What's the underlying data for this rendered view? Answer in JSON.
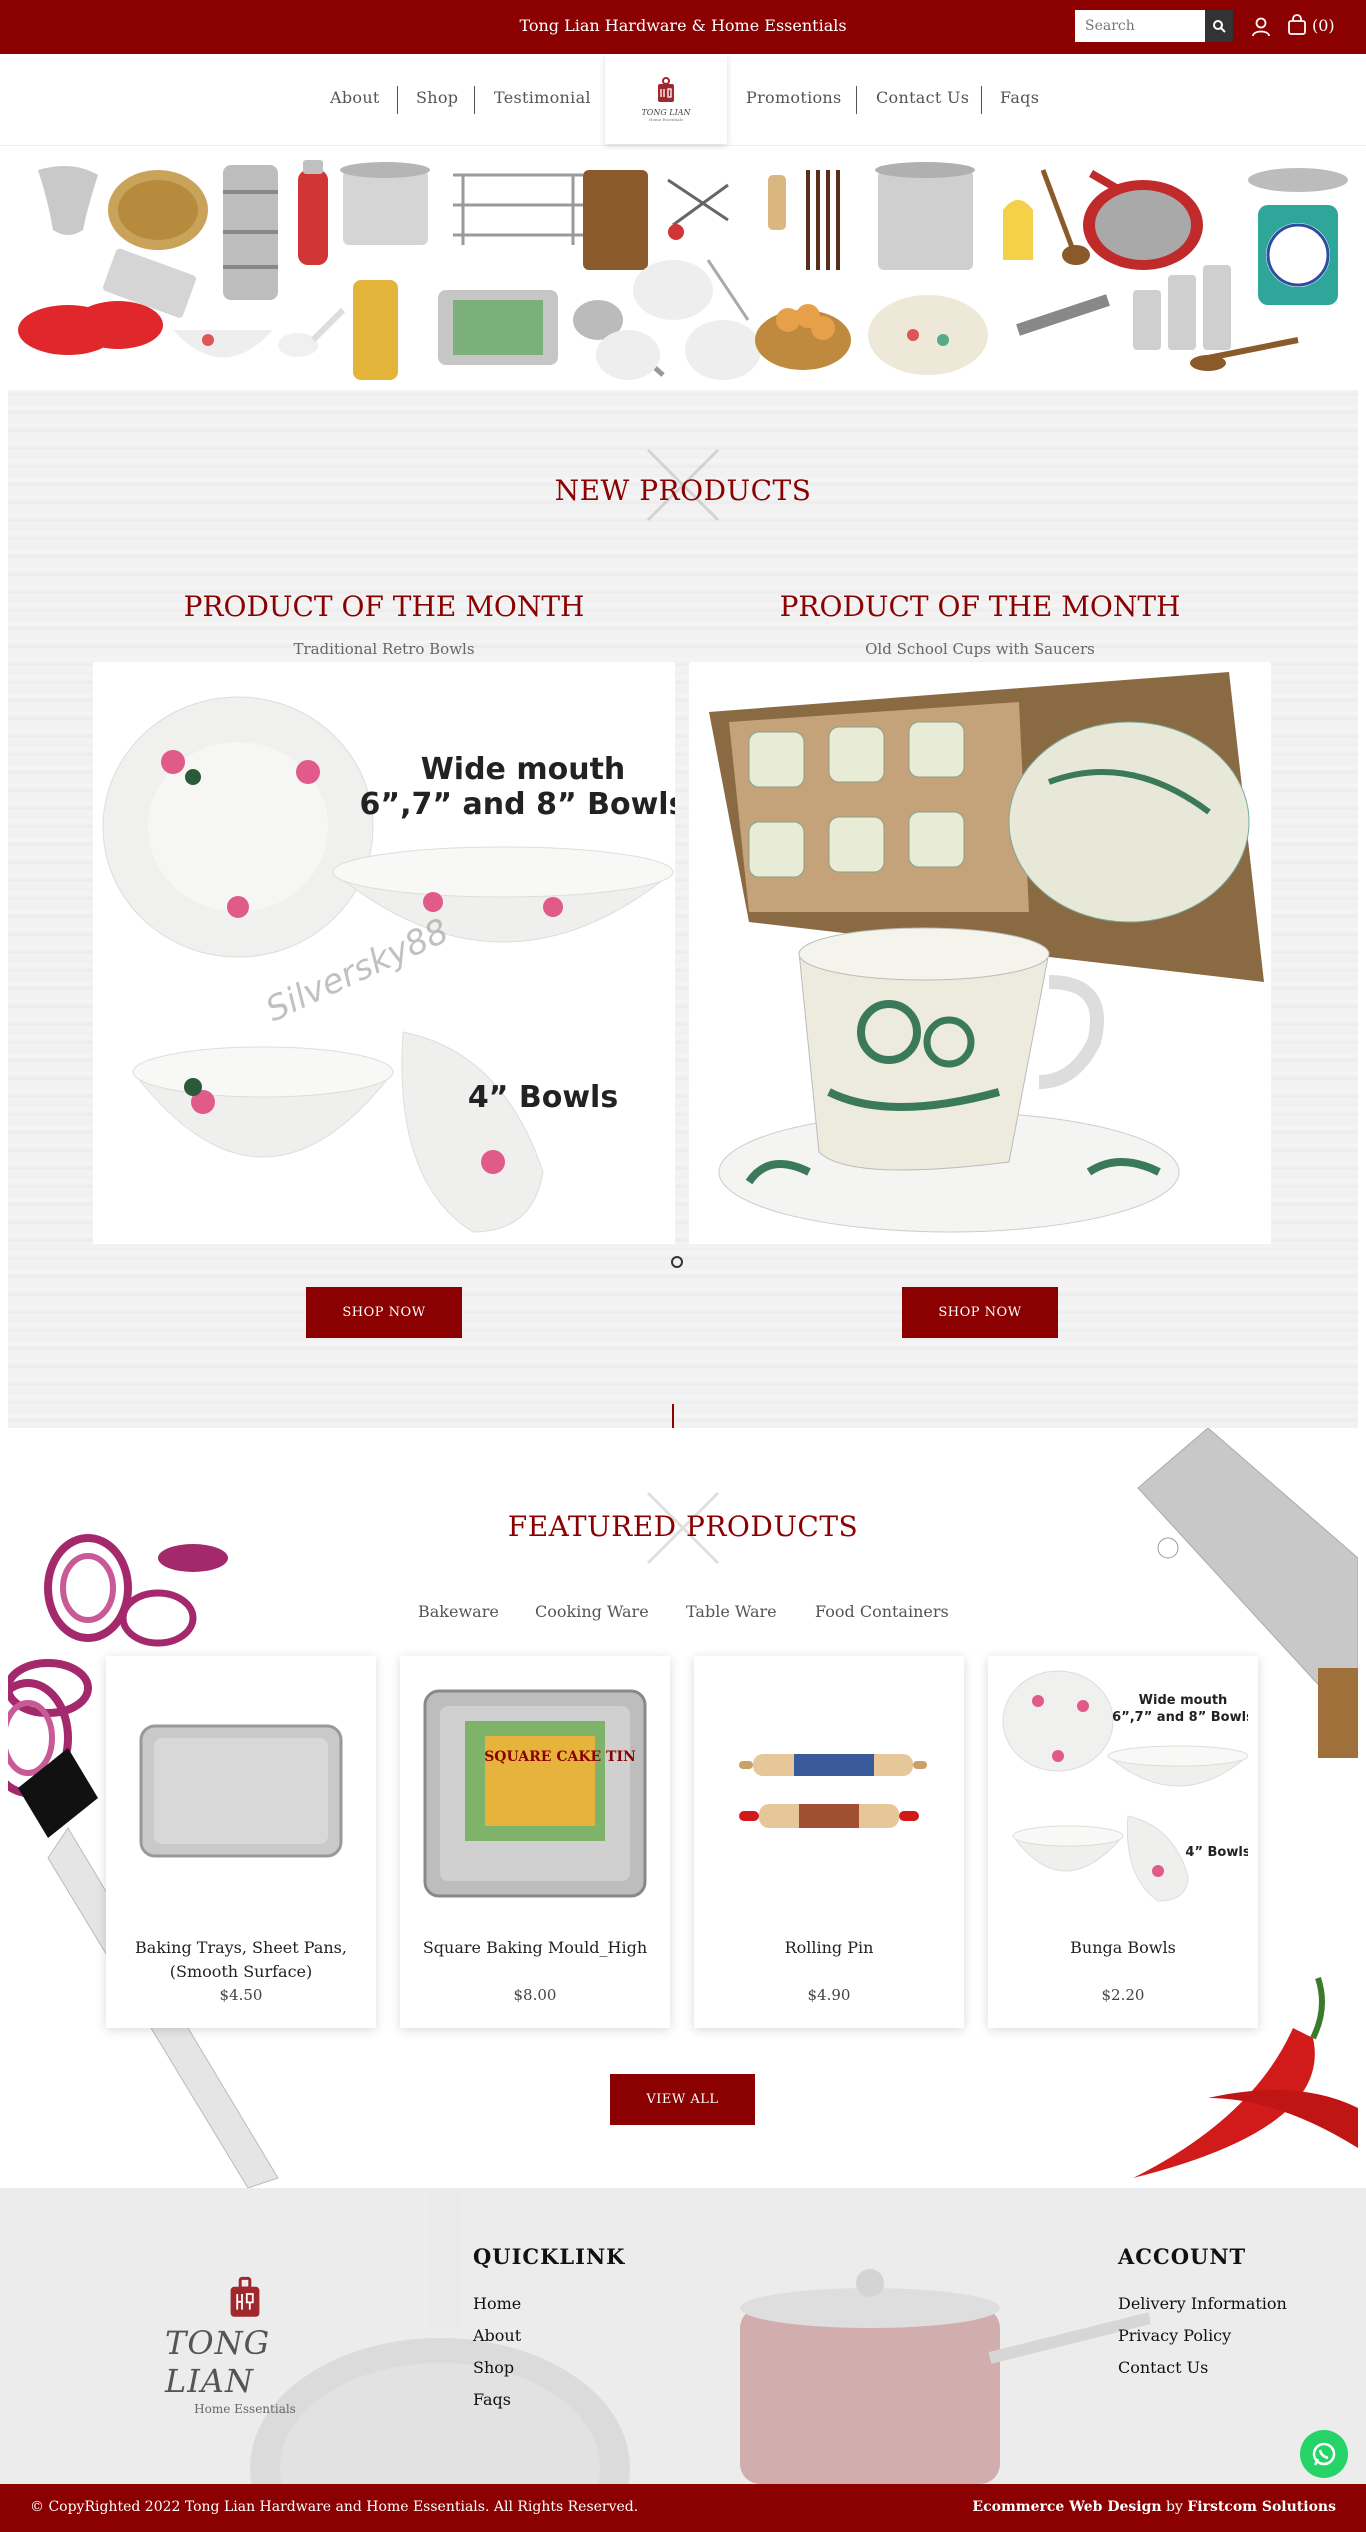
{
  "topbar": {
    "store_title": "Tong Lian Hardware & Home Essentials",
    "search_placeholder": "Search",
    "cart_count": "(0)"
  },
  "nav": {
    "items": [
      "About",
      "Shop",
      "Testimonial",
      "Promotions",
      "Contact Us",
      "Faqs"
    ],
    "logo_text": "TONG LIAN",
    "logo_sub": "Home Essentials"
  },
  "new_products": {
    "title": "NEW PRODUCTS",
    "products": [
      {
        "title": "PRODUCT OF THE MONTH",
        "subtitle": "Traditional Retro Bowls",
        "image_text_1": "Wide mouth",
        "image_text_2": "6”,7” and 8” Bowls",
        "image_text_3": "4” Bowls",
        "watermark": "Silversky88",
        "button": "SHOP NOW"
      },
      {
        "title": "PRODUCT OF THE MONTH",
        "subtitle": "Old School Cups with Saucers",
        "button": "SHOP NOW"
      }
    ]
  },
  "featured": {
    "title": "FEATURED PRODUCTS",
    "tabs": [
      "Bakeware",
      "Cooking Ware",
      "Table Ware",
      "Food Containers"
    ],
    "cards": [
      {
        "name": "Baking Trays, Sheet Pans, (Smooth Surface)",
        "price": "$4.50"
      },
      {
        "name": "Square Baking Mould_High",
        "price": "$8.00"
      },
      {
        "name": "Rolling Pin",
        "price": "$4.90"
      },
      {
        "name": "Bunga Bowls",
        "price": "$2.20"
      }
    ],
    "card_square_label": "SQUARE CAKE TIN",
    "card_bowls_text_1": "Wide mouth",
    "card_bowls_text_2": "6”,7” and 8” Bowls",
    "card_bowls_text_3": "4” Bowls",
    "view_all": "VIEW ALL"
  },
  "footer": {
    "logo_text": "TONG LIAN",
    "logo_sub": "Home Essentials",
    "quicklink_title": "QUICKLINK",
    "quicklinks": [
      "Home",
      "About",
      "Shop",
      "Faqs"
    ],
    "account_title": "ACCOUNT",
    "account_links": [
      "Delivery Information",
      "Privacy Policy",
      "Contact Us"
    ]
  },
  "bottombar": {
    "copyright": "© CopyRighted 2022 Tong Lian Hardware and Home Essentials. All Rights Reserved.",
    "credit_prefix": "Ecommerce Web Design",
    "credit_by": " by ",
    "credit_company": "Firstcom Solutions"
  },
  "colors": {
    "brand": "#8b0000",
    "whatsapp": "#25d366"
  }
}
